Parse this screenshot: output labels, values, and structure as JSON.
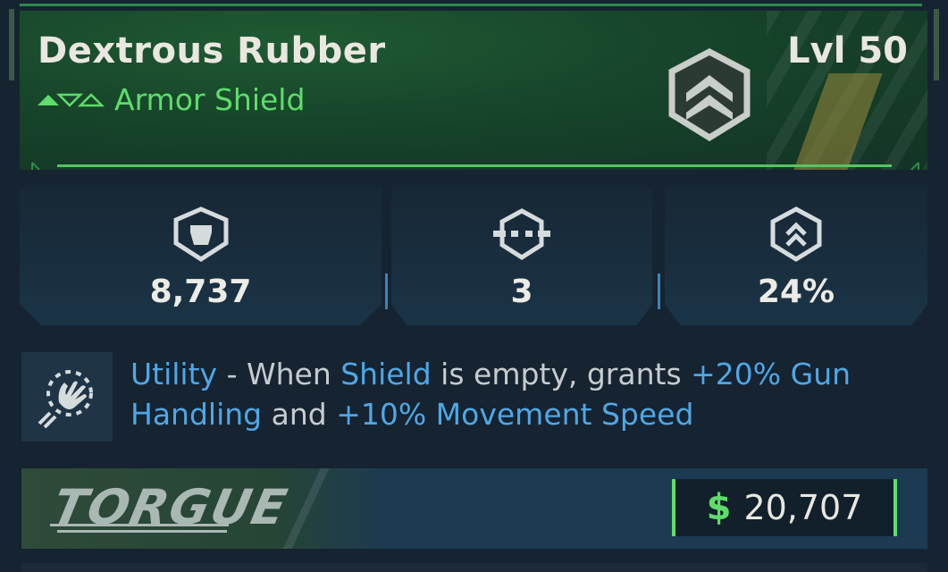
{
  "item": {
    "name": "Dextrous Rubber",
    "type": "Armor Shield",
    "level": "Lvl 50"
  },
  "stats": [
    {
      "icon": "shield-capacity-icon",
      "value": "8,737"
    },
    {
      "icon": "armor-segments-icon",
      "value": "3"
    },
    {
      "icon": "shield-upgrade-icon",
      "value": "24%"
    }
  ],
  "perk": {
    "icon": "hand-grab-icon",
    "category": "Utility",
    "seg1": " - When ",
    "keyword1": "Shield",
    "seg2": " is empty, grants ",
    "keyword2": "+20% Gun Handling",
    "seg3": " and ",
    "keyword3": "+10% Movement Speed"
  },
  "footer": {
    "manufacturer": "TORGUE",
    "currency_symbol": "$",
    "price": "20,707"
  },
  "colors": {
    "rarity_green": "#5fdc6b",
    "highlight_blue": "#4fa7e6"
  }
}
